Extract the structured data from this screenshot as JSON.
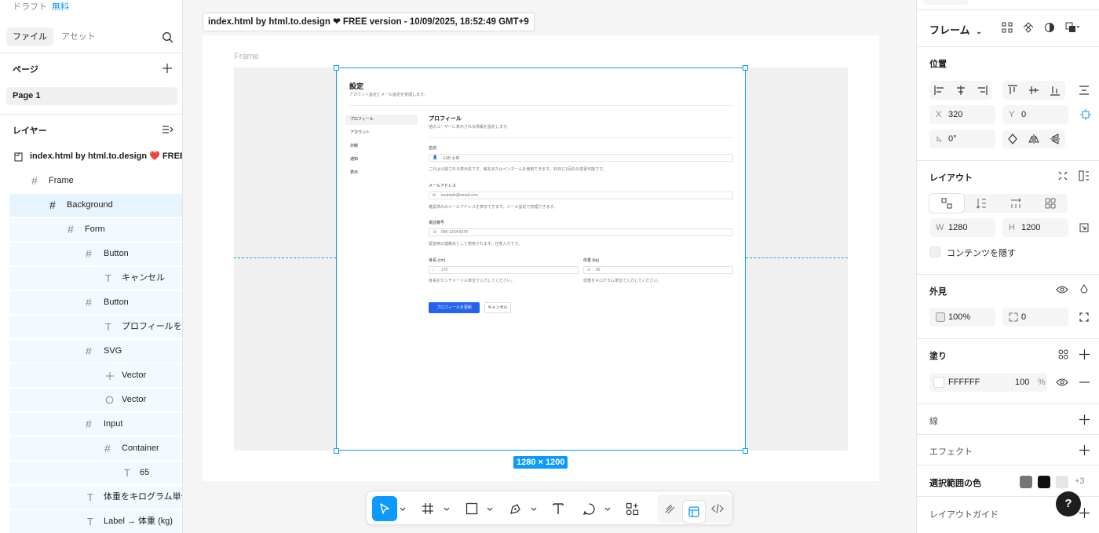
{
  "left": {
    "breadcrumb": "ドラフト",
    "plan": "無料",
    "tab_file": "ファイル",
    "tab_assets": "アセット",
    "pages_title": "ページ",
    "page1": "Page 1",
    "layers_title": "レイヤー",
    "layers": [
      {
        "label": "index.html by html.to.design ❤️ FREE",
        "icon": "page-icon"
      },
      {
        "label": "Frame",
        "icon": "frame-icon"
      },
      {
        "label": "Background",
        "icon": "frame-icon"
      },
      {
        "label": "Form",
        "icon": "frame-icon"
      },
      {
        "label": "Button",
        "icon": "frame-icon"
      },
      {
        "label": "キャンセル",
        "icon": "text-icon"
      },
      {
        "label": "Button",
        "icon": "frame-icon"
      },
      {
        "label": "プロフィールを更",
        "icon": "text-icon"
      },
      {
        "label": "SVG",
        "icon": "frame-icon"
      },
      {
        "label": "Vector",
        "icon": "vector-plus-icon"
      },
      {
        "label": "Vector",
        "icon": "ellipse-icon"
      },
      {
        "label": "Input",
        "icon": "frame-icon"
      },
      {
        "label": "Container",
        "icon": "frame-icon"
      },
      {
        "label": "65",
        "icon": "text-icon"
      },
      {
        "label": "体重をキログラム単位",
        "icon": "text-icon"
      },
      {
        "label": "Label → 体重 (kg)",
        "icon": "text-icon"
      }
    ]
  },
  "canvas": {
    "file_tag": "index.html by html.to.design ❤ FREE version - 10/09/2025, 18:52:49 GMT+9",
    "frame_label": "Frame",
    "dimensions": "1280 × 1200"
  },
  "mini": {
    "title": "設定",
    "subtitle": "アカウント設定とメール設定を管理します。",
    "nav": [
      "プロフィール",
      "アカウント",
      "外観",
      "通知",
      "表示"
    ],
    "section_title": "プロフィール",
    "section_desc": "他のユーザーに表示される情報を設定します。",
    "name_label": "名前",
    "name_placeholder": "山田 太郎",
    "name_help": "これは公開される表示名です。実名またはペンネームを使用できます。30日に1回のみ変更可能です。",
    "email_label": "メールアドレス",
    "email_placeholder": "example@email.com",
    "email_help": "確認済みのメールアドレスを表示できます。メール設定で管理できます。",
    "phone_label": "電話番号",
    "phone_placeholder": "090-1234-5678",
    "phone_help": "緊急時の連絡先として使用されます。任意入力です。",
    "height_label": "身長 (cm)",
    "height_value": "170",
    "height_help": "身長をセンチメートル単位で入力してください。",
    "weight_label": "体重 (kg)",
    "weight_value": "65",
    "weight_help": "体重をキログラム単位で入力してください。",
    "submit": "プロフィールを更新",
    "cancel": "キャンセル"
  },
  "right": {
    "frame_selector": "フレーム",
    "position_title": "位置",
    "x_key": "X",
    "x": "320",
    "y_key": "Y",
    "y": "0",
    "rotation": "0°",
    "layout_title": "レイアウト",
    "w_key": "W",
    "w": "1280",
    "h_key": "H",
    "h": "1200",
    "clip_label": "コンテンツを隠す",
    "appearance_title": "外見",
    "opacity": "100%",
    "radius": "0",
    "fill_title": "塗り",
    "fill_hex": "FFFFFF",
    "fill_opacity": "100",
    "fill_pct": "%",
    "stroke_title": "線",
    "effects_title": "エフェクト",
    "selection_colors_title": "選択範囲の色",
    "selection_colors": [
      "#757575",
      "#111111",
      "#e6e6e6"
    ],
    "selection_more": "+3",
    "layout_guide_title": "レイアウトガイド"
  },
  "help": "?",
  "colors": {
    "accent": "#0d99ff",
    "primary_button": "#2563eb"
  }
}
